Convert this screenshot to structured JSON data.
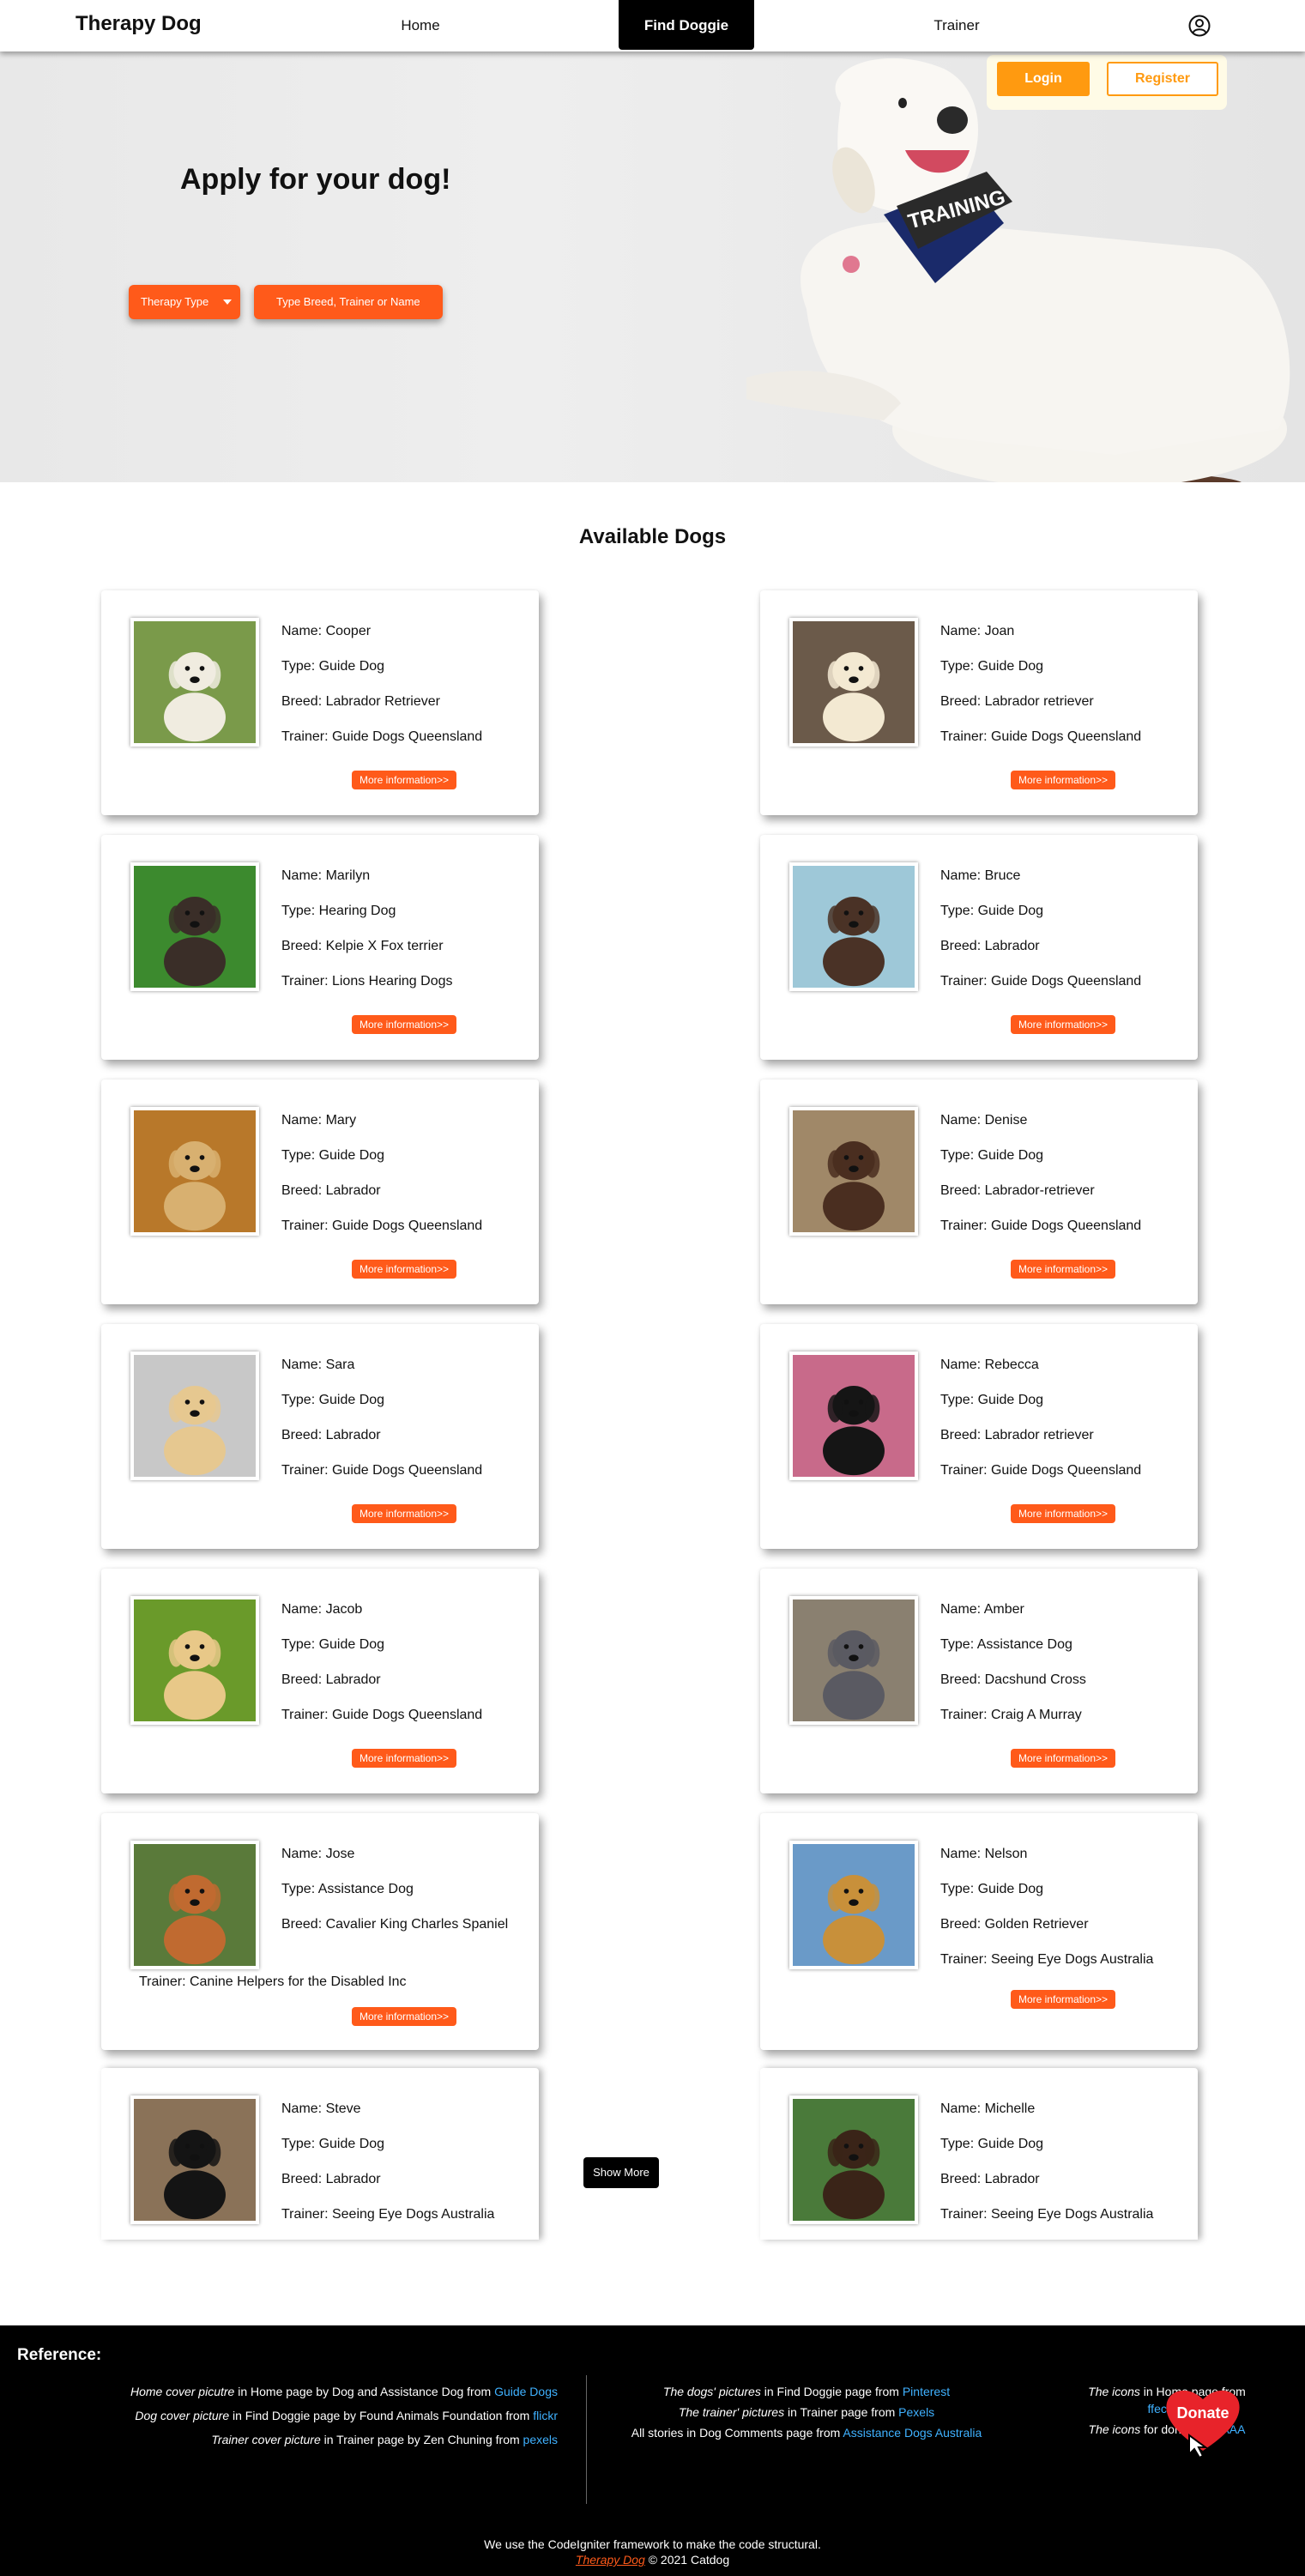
{
  "nav": {
    "brand": "Therapy Dog",
    "home": "Home",
    "find": "Find Doggie",
    "trainer": "Trainer"
  },
  "hero": {
    "title": "Apply for your dog!",
    "therapy_type": "Therapy Type",
    "search_placeholder": "Type Breed, Trainer or Name",
    "login": "Login",
    "register": "Register",
    "harness_text": "TRAINING"
  },
  "section": {
    "title": "Available Dogs"
  },
  "more_label": "More information>>",
  "show_more": "Show More",
  "dogs": [
    {
      "name": "Name: Cooper",
      "type": "Type: Guide Dog",
      "breed": "Breed: Labrador Retriever",
      "trainer": "Trainer: Guide Dogs Queensland",
      "photo_bg": "#7a9a4a",
      "dog_color": "#f0ece0"
    },
    {
      "name": "Name: Joan",
      "type": "Type: Guide Dog",
      "breed": "Breed: Labrador retriever",
      "trainer": "Trainer: Guide Dogs Queensland",
      "photo_bg": "#6b5a4a",
      "dog_color": "#f3e9d2"
    },
    {
      "name": "Name: Marilyn",
      "type": "Type: Hearing Dog",
      "breed": "Breed: Kelpie X Fox terrier",
      "trainer": "Trainer: Lions Hearing Dogs",
      "photo_bg": "#3c8a2e",
      "dog_color": "#3a2e28"
    },
    {
      "name": "Name: Bruce",
      "type": "Type: Guide Dog",
      "breed": "Breed: Labrador",
      "trainer": "Trainer: Guide Dogs Queensland",
      "photo_bg": "#9ec8d8",
      "dog_color": "#4a3226"
    },
    {
      "name": "Name: Mary",
      "type": "Type: Guide Dog",
      "breed": "Breed: Labrador",
      "trainer": "Trainer: Guide Dogs Queensland",
      "photo_bg": "#b8782a",
      "dog_color": "#d8b070"
    },
    {
      "name": "Name: Denise",
      "type": "Type: Guide Dog",
      "breed": "Breed: Labrador-retriever",
      "trainer": "Trainer: Guide Dogs Queensland",
      "photo_bg": "#a08868",
      "dog_color": "#4a2e20"
    },
    {
      "name": "Name: Sara",
      "type": "Type: Guide Dog",
      "breed": "Breed: Labrador",
      "trainer": "Trainer: Guide Dogs Queensland",
      "photo_bg": "#c8c8c8",
      "dog_color": "#e6c890"
    },
    {
      "name": "Name: Rebecca",
      "type": "Type: Guide Dog",
      "breed": "Breed: Labrador retriever",
      "trainer": "Trainer: Guide Dogs Queensland",
      "photo_bg": "#c86a8a",
      "dog_color": "#151515"
    },
    {
      "name": "Name: Jacob",
      "type": "Type: Guide Dog",
      "breed": "Breed: Labrador",
      "trainer": "Trainer: Guide Dogs Queensland",
      "photo_bg": "#6a9a2a",
      "dog_color": "#e8c888"
    },
    {
      "name": "Name: Amber",
      "type": "Type: Assistance Dog",
      "breed": "Breed: Dacshund Cross",
      "trainer": "Trainer: Craig A Murray",
      "photo_bg": "#8a8070",
      "dog_color": "#5a5a62"
    },
    {
      "name": "Name: Jose",
      "type": "Type: Assistance Dog",
      "breed": "Breed: Cavalier King Charles Spaniel",
      "trainer": "Trainer: Canine Helpers for the Disabled Inc",
      "photo_bg": "#5a7a3a",
      "dog_color": "#c06a30"
    },
    {
      "name": "Name: Nelson",
      "type": "Type: Guide Dog",
      "breed": "Breed: Golden Retriever",
      "trainer": "Trainer: Seeing Eye Dogs Australia",
      "photo_bg": "#6a9ac8",
      "dog_color": "#c8903a"
    },
    {
      "name": "Name: Steve",
      "type": "Type: Guide Dog",
      "breed": "Breed: Labrador",
      "trainer": "Trainer: Seeing Eye Dogs Australia",
      "photo_bg": "#8a7258",
      "dog_color": "#141414"
    },
    {
      "name": "Name: Michelle",
      "type": "Type: Guide Dog",
      "breed": "Breed: Labrador",
      "trainer": "Trainer: Seeing Eye Dogs Australia",
      "photo_bg": "#4a7a3a",
      "dog_color": "#3a2418"
    }
  ],
  "footer": {
    "title": "Reference:",
    "a1_i": "Home cover picutre",
    "a1_t": " in Home page by Dog and Assistance Dog from ",
    "a1_l": "Guide Dogs",
    "a2_i": "Dog cover picture",
    "a2_t": " in Find Doggie page by Found Animals Foundation from ",
    "a2_l": "flickr",
    "a3_i": "Trainer cover picture",
    "a3_t": " in Trainer page by Zen Chuning from ",
    "a3_l": "pexels",
    "b1_i": "The dogs' pictures",
    "b1_t": " in Find Doggie page from ",
    "b1_l": "Pinterest",
    "b2_i": "The trainer' pictures",
    "b2_t": " in Trainer page from ",
    "b2_l": "Pexels",
    "b3_t": "All stories in Dog Comments page from ",
    "b3_l": "Assistance Dogs Australia",
    "c1_i": "The icons",
    "c1_t": " in Home page from",
    "c1_l": "ffection",
    "c2_i": "The icons",
    "c2_t": " for donate",
    "c2_l": "ohnAAA",
    "credit_line": "We use the CodeIgniter framework to make the code structural.",
    "credit_brand": "Therapy Dog",
    "credit_year": " © 2021 Catdog",
    "donate": "Donate"
  },
  "colors": {
    "accent": "#ff5a1a",
    "auth": "#ff9a10",
    "link": "#3fb1ff"
  }
}
